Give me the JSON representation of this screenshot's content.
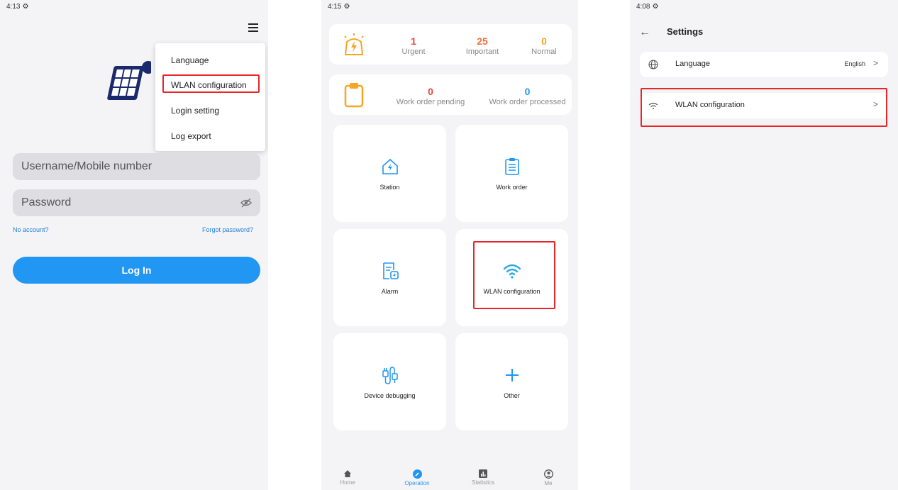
{
  "screen1": {
    "status_time": "4:13",
    "menu": [
      "Language",
      "WLAN configuration",
      "Login setting",
      "Log export"
    ],
    "username_placeholder": "Username/Mobile number",
    "password_placeholder": "Password",
    "no_account": "No account?",
    "forgot_password": "Forgot password?",
    "login_button": "Log In"
  },
  "screen2": {
    "status_time": "4:15",
    "alarms": [
      {
        "value": "1",
        "label": "Urgent"
      },
      {
        "value": "25",
        "label": "Important"
      },
      {
        "value": "0",
        "label": "Normal"
      }
    ],
    "work_orders": [
      {
        "value": "0",
        "label": "Work order pending"
      },
      {
        "value": "0",
        "label": "Work order processed"
      }
    ],
    "tiles": [
      "Station",
      "Work order",
      "Alarm",
      "WLAN configuration",
      "Device debugging",
      "Other"
    ],
    "nav": [
      "Home",
      "Operation",
      "Statistics",
      "Me"
    ],
    "colors": {
      "urgent": "#e8453c",
      "important": "#f0703c",
      "normal": "#f5a623",
      "accent": "#2196f3"
    }
  },
  "screen3": {
    "status_time": "4:08",
    "title": "Settings",
    "rows": [
      {
        "label": "Language",
        "value": "English"
      },
      {
        "label": "WLAN configuration",
        "value": ""
      }
    ]
  }
}
